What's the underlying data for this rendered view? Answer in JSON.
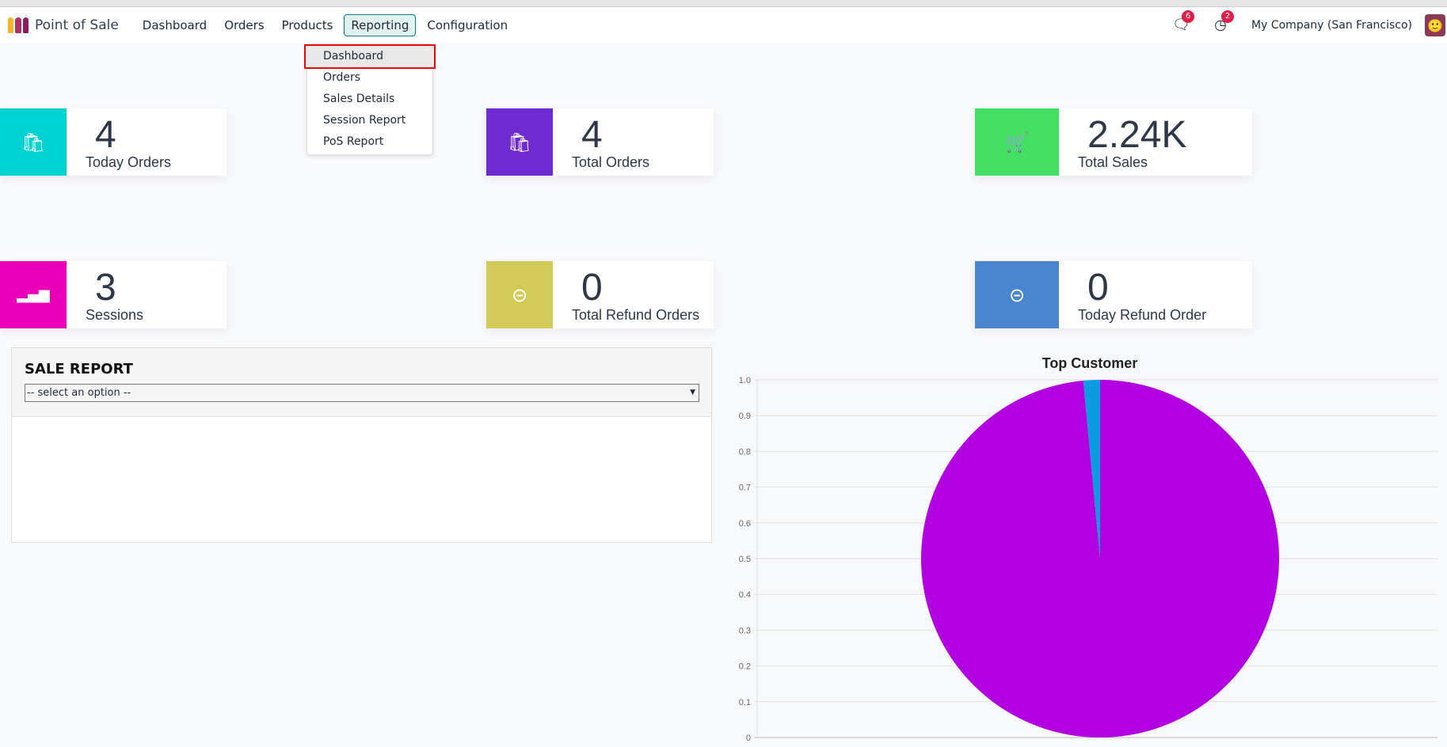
{
  "navbar": {
    "app_title": "Point of Sale",
    "menu": [
      "Dashboard",
      "Orders",
      "Products",
      "Reporting",
      "Configuration"
    ],
    "active": "Reporting",
    "messages_count": "6",
    "activities_count": "2",
    "company": "My Company (San Francisco)"
  },
  "reporting_dropdown": {
    "items": [
      "Dashboard",
      "Orders",
      "Sales Details",
      "Session Report",
      "PoS Report"
    ],
    "highlighted": "Dashboard"
  },
  "cards": [
    {
      "value": "4",
      "label": "Today Orders",
      "color": "#00d1d1",
      "icon": "shopping-bag-icon"
    },
    {
      "value": "4",
      "label": "Total Orders",
      "color": "#6f2bd1",
      "icon": "shopping-bag-icon"
    },
    {
      "value": "2.24K",
      "label": "Total Sales",
      "color": "#44e064",
      "icon": "cart-icon"
    },
    {
      "value": "3",
      "label": "Sessions",
      "color": "#ec00b8",
      "icon": "signal-icon"
    },
    {
      "value": "0",
      "label": "Total Refund Orders",
      "color": "#d2cb5a",
      "icon": "minus-circle-icon"
    },
    {
      "value": "0",
      "label": "Today Refund Order",
      "color": "#4a86d0",
      "icon": "minus-circle-icon"
    }
  ],
  "sale_report": {
    "title": "SALE REPORT",
    "select_value": "-- select an option --"
  },
  "chart_data": {
    "type": "pie",
    "title": "Top Customer",
    "yticks": [
      "0",
      "0.1",
      "0.2",
      "0.3",
      "0.4",
      "0.5",
      "0.6",
      "0.7",
      "0.8",
      "0.9",
      "1.0"
    ],
    "ylim": [
      0,
      1
    ],
    "grid": true,
    "series": [
      {
        "name": "",
        "value": 0.985,
        "color": "#b300e0"
      },
      {
        "name": "",
        "value": 0.015,
        "color": "#0a9be0"
      }
    ]
  }
}
